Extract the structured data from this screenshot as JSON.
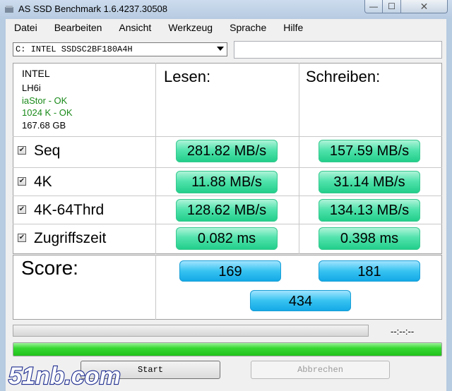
{
  "window": {
    "title": "AS SSD Benchmark 1.6.4237.30508"
  },
  "menu": [
    "Datei",
    "Bearbeiten",
    "Ansicht",
    "Werkzeug",
    "Sprache",
    "Hilfe"
  ],
  "drive": {
    "selected": "C: INTEL SSDSC2BF180A4H",
    "side_value": ""
  },
  "info": {
    "vendor": "INTEL",
    "firmware": "LH6i",
    "driver": "iaStor - OK",
    "alignment": "1024 K - OK",
    "capacity": "167.68 GB"
  },
  "headers": {
    "read": "Lesen:",
    "write": "Schreiben:"
  },
  "rows": [
    {
      "label": "Seq",
      "read": "281.82 MB/s",
      "write": "157.59 MB/s",
      "checked": true
    },
    {
      "label": "4K",
      "read": "11.88 MB/s",
      "write": "31.14 MB/s",
      "checked": true
    },
    {
      "label": "4K-64Thrd",
      "read": "128.62 MB/s",
      "write": "134.13 MB/s",
      "checked": true
    },
    {
      "label": "Zugriffszeit",
      "read": "0.082 ms",
      "write": "0.398 ms",
      "checked": true
    }
  ],
  "score": {
    "label": "Score:",
    "read": "169",
    "write": "181",
    "total": "434"
  },
  "status": {
    "time": "--:--:--",
    "progress_fraction": 1.0
  },
  "buttons": {
    "start": "Start",
    "abort": "Abbrechen"
  },
  "watermark": "51nb.com",
  "colors": {
    "result_green": "#34d99a",
    "score_blue": "#29b6ee",
    "progress_green": "#2fd22a"
  }
}
